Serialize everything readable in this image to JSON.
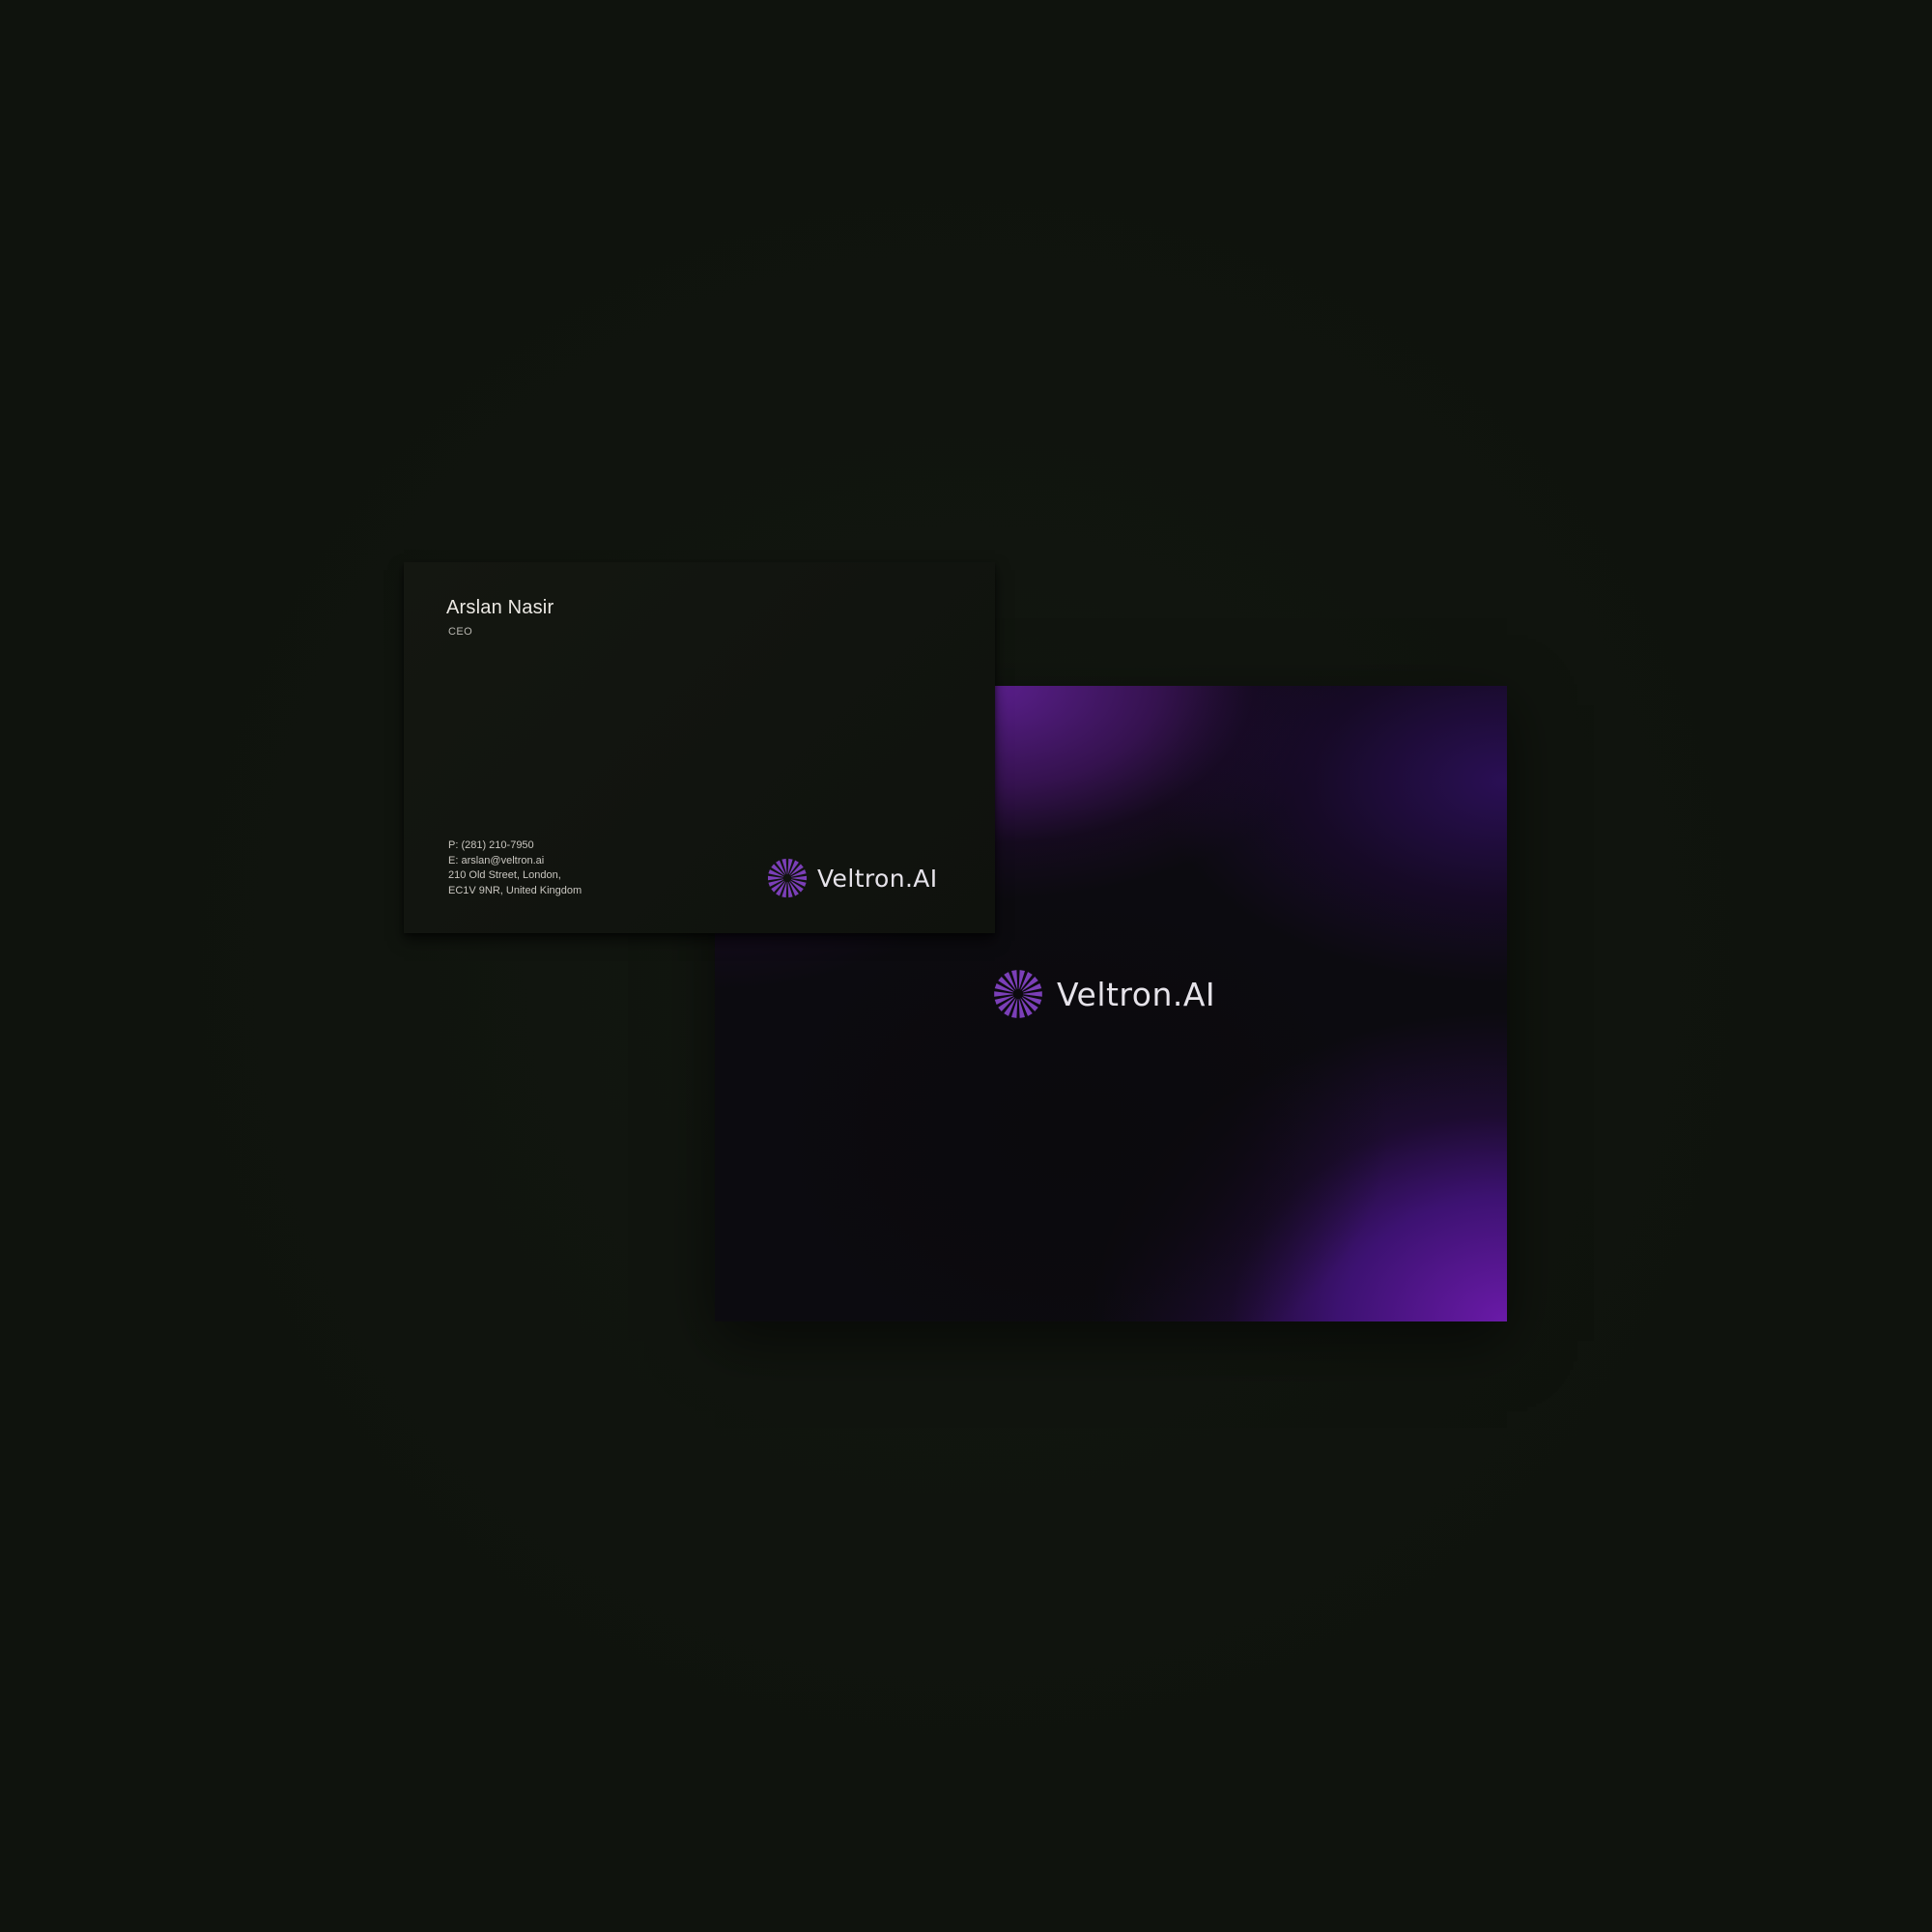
{
  "brand": {
    "name": "Veltron.AI",
    "accent_color": "#7b3fb8",
    "logo_icon": "radial-sunburst-icon"
  },
  "front_card": {
    "person_name": "Arslan Nasir",
    "role": "CEO",
    "phone": "P: (281) 210-7950",
    "email": "E: arslan@veltron.ai",
    "address_line1": "210 Old Street, London,",
    "address_line2": "EC1V 9NR, United Kingdom"
  },
  "back_card": {
    "gradient_colors": [
      "#6a1aa8",
      "#3d1272",
      "#0c0b10"
    ]
  },
  "background_color": "#0f130d"
}
